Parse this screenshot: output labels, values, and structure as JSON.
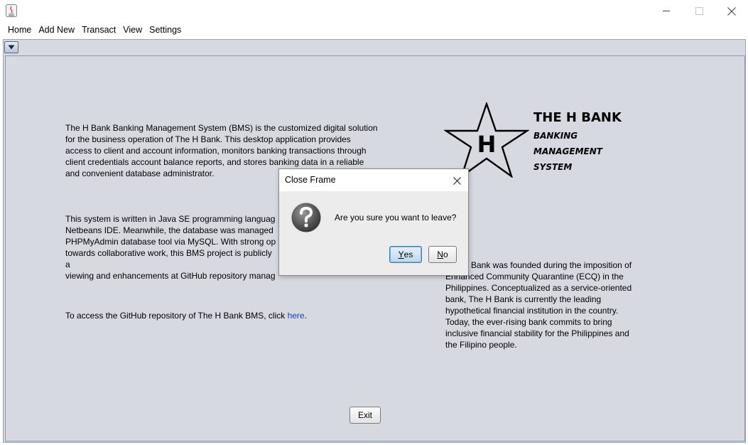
{
  "window": {
    "menu": [
      "Home",
      "Add New",
      "Transact",
      "View",
      "Settings"
    ]
  },
  "left_column": {
    "paragraph1_lines": [
      "The H Bank Banking Management System (BMS) is the customized digital solution",
      "for the business operation of The H Bank. This desktop application provides",
      "access to client and account information, monitors banking transactions through",
      "client credentials account balance reports, and stores banking data in a reliable",
      "and convenient database administrator."
    ],
    "paragraph2_lines": [
      "This system is written in Java SE programming languag",
      "Netbeans IDE. Meanwhile, the database was managed",
      "PHPMyAdmin database tool via MySQL. With strong op",
      "towards collaborative work, this BMS project is publicly a",
      "viewing and enhancements at GitHub repository manag"
    ],
    "github_text": "To access the GitHub repository of The H Bank BMS, click ",
    "github_link": "here",
    "github_suffix": "."
  },
  "logo": {
    "letter": "H",
    "title": "THE H BANK",
    "subtitle_lines": [
      "BANKING",
      "MANAGEMENT",
      "SYSTEM"
    ]
  },
  "right_column": {
    "lines": [
      "Bank was founded during the imposition of",
      "Enhanced Community Quarantine (ECQ) in the",
      "Philippines. Conceptualized as a service-oriented",
      "bank, The H Bank is currently the leading",
      "hypothetical financial institution in the country.",
      "Today, the ever-rising bank commits to bring",
      "inclusive financial stability for the Philippines and",
      "the Filipino people."
    ]
  },
  "exit_button": "Exit",
  "dialog": {
    "title": "Close Frame",
    "message": "Are you sure you want to leave?",
    "yes_first": "Y",
    "yes_rest": "es",
    "no_first": "N",
    "no_rest": "o"
  },
  "colors": {
    "panel_bg": "#d6d9df",
    "link": "#1f3fbf",
    "dialog_bg": "#ececec"
  }
}
